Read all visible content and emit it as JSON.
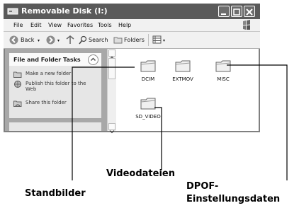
{
  "window": {
    "title": "Removable Disk (I:)"
  },
  "menu": {
    "file": "File",
    "edit": "Edit",
    "view": "View",
    "favorites": "Favorites",
    "tools": "Tools",
    "help": "Help"
  },
  "toolbar": {
    "back": "Back",
    "search": "Search",
    "folders": "Folders"
  },
  "tasks": {
    "header": "File and Folder Tasks",
    "items": [
      {
        "label": "Make a new folder",
        "icon": "new-folder-icon"
      },
      {
        "label": "Publish this folder to the Web",
        "icon": "globe-icon"
      },
      {
        "label": "Share this folder",
        "icon": "share-folder-icon"
      }
    ]
  },
  "folders": [
    {
      "name": "DCIM"
    },
    {
      "name": "EXTMOV"
    },
    {
      "name": "MISC"
    },
    {
      "name": "SD_VIDEO"
    }
  ],
  "annotations": {
    "videodateien": "Videodateien",
    "standbilder": "Standbilder",
    "dpof_line1": "DPOF-",
    "dpof_line2": "Einstellungsdaten"
  }
}
